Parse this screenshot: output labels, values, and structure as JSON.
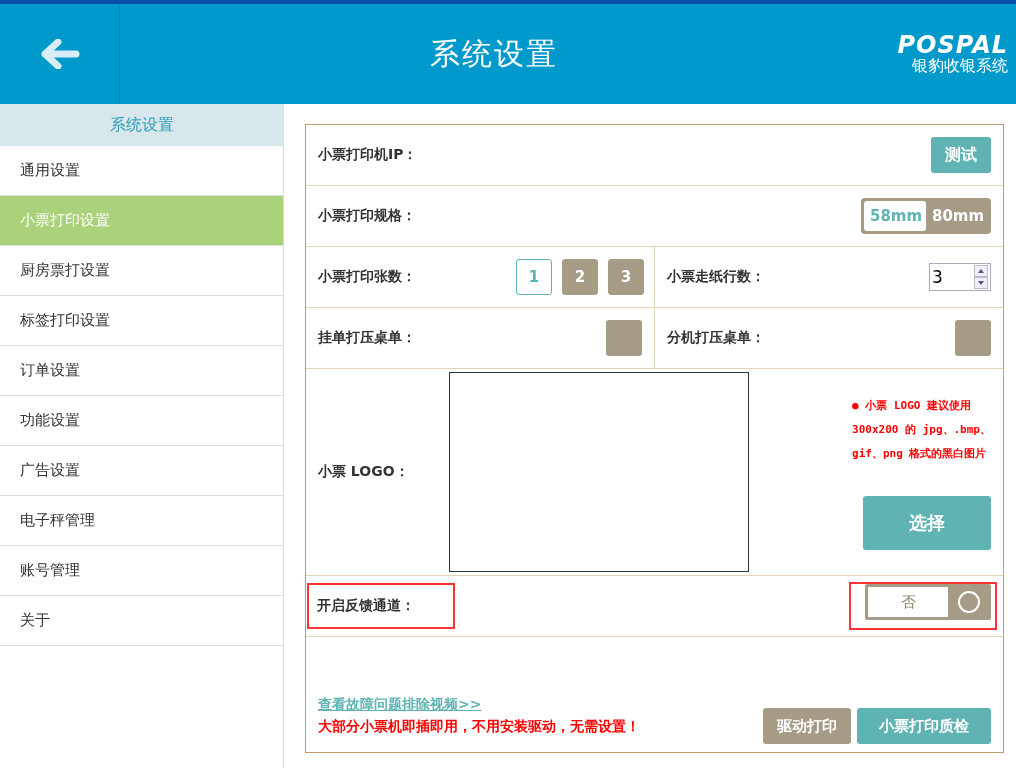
{
  "header": {
    "title": "系统设置",
    "brand": "POSPAL",
    "brand_subtitle": "银豹收银系统"
  },
  "sidebar": {
    "title": "系统设置",
    "items": [
      {
        "label": "通用设置",
        "selected": false
      },
      {
        "label": "小票打印设置",
        "selected": true
      },
      {
        "label": "厨房票打设置",
        "selected": false
      },
      {
        "label": "标签打印设置",
        "selected": false
      },
      {
        "label": "订单设置",
        "selected": false
      },
      {
        "label": "功能设置",
        "selected": false
      },
      {
        "label": "广告设置",
        "selected": false
      },
      {
        "label": "电子秤管理",
        "selected": false
      },
      {
        "label": "账号管理",
        "selected": false
      },
      {
        "label": "关于",
        "selected": false
      }
    ]
  },
  "printer_ip": {
    "label": "小票打印机IP：",
    "button": "测试"
  },
  "paper_size": {
    "label": "小票打印规格：",
    "options": [
      {
        "label": "58mm",
        "selected": true
      },
      {
        "label": "80mm",
        "selected": false
      }
    ]
  },
  "copies": {
    "label": "小票打印张数：",
    "options": [
      {
        "label": "1",
        "selected": true
      },
      {
        "label": "2",
        "selected": false
      },
      {
        "label": "3",
        "selected": false
      }
    ]
  },
  "feed_lines": {
    "label": "小票走纸行数：",
    "value": "3"
  },
  "hold_order_print": {
    "label": "挂单打压桌单：",
    "checked": false
  },
  "sub_terminal_print": {
    "label": "分机打压桌单：",
    "checked": false
  },
  "logo": {
    "label": "小票 LOGO：",
    "notice": [
      "● 小票 LOGO 建议使用",
      "300x200 的 jpg、.bmp、",
      "gif、png 格式的黑白图片"
    ],
    "button": "选择"
  },
  "feedback_channel": {
    "label": "开启反馈通道：",
    "value": "否",
    "on": false,
    "highlighted": true
  },
  "footer": {
    "link": "查看故障问题排除视频>>",
    "warning": "大部分小票机即插即用，不用安装驱动，无需设置！",
    "buttons": [
      {
        "label": "驱动打印",
        "kind": "secondary"
      },
      {
        "label": "小票打印质检",
        "kind": "primary"
      }
    ]
  }
}
